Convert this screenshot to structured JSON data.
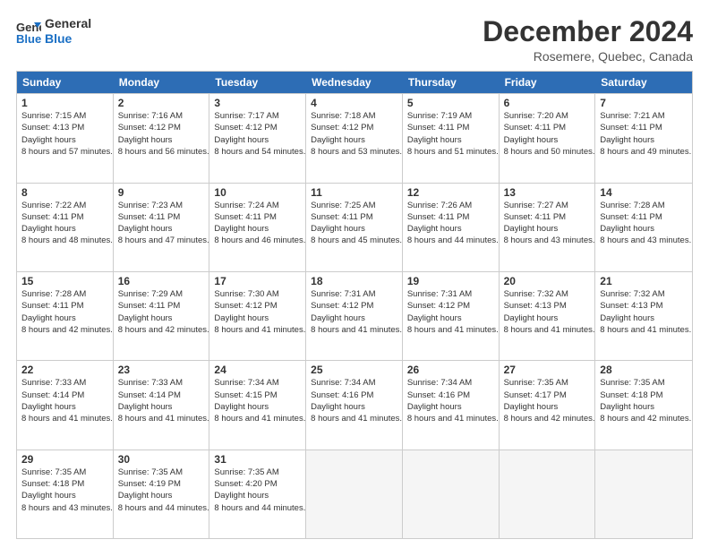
{
  "logo": {
    "line1": "General",
    "line2": "Blue"
  },
  "title": "December 2024",
  "location": "Rosemere, Quebec, Canada",
  "weekdays": [
    "Sunday",
    "Monday",
    "Tuesday",
    "Wednesday",
    "Thursday",
    "Friday",
    "Saturday"
  ],
  "weeks": [
    [
      {
        "day": "1",
        "sunrise": "7:15 AM",
        "sunset": "4:13 PM",
        "daylight": "8 hours and 57 minutes."
      },
      {
        "day": "2",
        "sunrise": "7:16 AM",
        "sunset": "4:12 PM",
        "daylight": "8 hours and 56 minutes."
      },
      {
        "day": "3",
        "sunrise": "7:17 AM",
        "sunset": "4:12 PM",
        "daylight": "8 hours and 54 minutes."
      },
      {
        "day": "4",
        "sunrise": "7:18 AM",
        "sunset": "4:12 PM",
        "daylight": "8 hours and 53 minutes."
      },
      {
        "day": "5",
        "sunrise": "7:19 AM",
        "sunset": "4:11 PM",
        "daylight": "8 hours and 51 minutes."
      },
      {
        "day": "6",
        "sunrise": "7:20 AM",
        "sunset": "4:11 PM",
        "daylight": "8 hours and 50 minutes."
      },
      {
        "day": "7",
        "sunrise": "7:21 AM",
        "sunset": "4:11 PM",
        "daylight": "8 hours and 49 minutes."
      }
    ],
    [
      {
        "day": "8",
        "sunrise": "7:22 AM",
        "sunset": "4:11 PM",
        "daylight": "8 hours and 48 minutes."
      },
      {
        "day": "9",
        "sunrise": "7:23 AM",
        "sunset": "4:11 PM",
        "daylight": "8 hours and 47 minutes."
      },
      {
        "day": "10",
        "sunrise": "7:24 AM",
        "sunset": "4:11 PM",
        "daylight": "8 hours and 46 minutes."
      },
      {
        "day": "11",
        "sunrise": "7:25 AM",
        "sunset": "4:11 PM",
        "daylight": "8 hours and 45 minutes."
      },
      {
        "day": "12",
        "sunrise": "7:26 AM",
        "sunset": "4:11 PM",
        "daylight": "8 hours and 44 minutes."
      },
      {
        "day": "13",
        "sunrise": "7:27 AM",
        "sunset": "4:11 PM",
        "daylight": "8 hours and 43 minutes."
      },
      {
        "day": "14",
        "sunrise": "7:28 AM",
        "sunset": "4:11 PM",
        "daylight": "8 hours and 43 minutes."
      }
    ],
    [
      {
        "day": "15",
        "sunrise": "7:28 AM",
        "sunset": "4:11 PM",
        "daylight": "8 hours and 42 minutes."
      },
      {
        "day": "16",
        "sunrise": "7:29 AM",
        "sunset": "4:11 PM",
        "daylight": "8 hours and 42 minutes."
      },
      {
        "day": "17",
        "sunrise": "7:30 AM",
        "sunset": "4:12 PM",
        "daylight": "8 hours and 41 minutes."
      },
      {
        "day": "18",
        "sunrise": "7:31 AM",
        "sunset": "4:12 PM",
        "daylight": "8 hours and 41 minutes."
      },
      {
        "day": "19",
        "sunrise": "7:31 AM",
        "sunset": "4:12 PM",
        "daylight": "8 hours and 41 minutes."
      },
      {
        "day": "20",
        "sunrise": "7:32 AM",
        "sunset": "4:13 PM",
        "daylight": "8 hours and 41 minutes."
      },
      {
        "day": "21",
        "sunrise": "7:32 AM",
        "sunset": "4:13 PM",
        "daylight": "8 hours and 41 minutes."
      }
    ],
    [
      {
        "day": "22",
        "sunrise": "7:33 AM",
        "sunset": "4:14 PM",
        "daylight": "8 hours and 41 minutes."
      },
      {
        "day": "23",
        "sunrise": "7:33 AM",
        "sunset": "4:14 PM",
        "daylight": "8 hours and 41 minutes."
      },
      {
        "day": "24",
        "sunrise": "7:34 AM",
        "sunset": "4:15 PM",
        "daylight": "8 hours and 41 minutes."
      },
      {
        "day": "25",
        "sunrise": "7:34 AM",
        "sunset": "4:16 PM",
        "daylight": "8 hours and 41 minutes."
      },
      {
        "day": "26",
        "sunrise": "7:34 AM",
        "sunset": "4:16 PM",
        "daylight": "8 hours and 41 minutes."
      },
      {
        "day": "27",
        "sunrise": "7:35 AM",
        "sunset": "4:17 PM",
        "daylight": "8 hours and 42 minutes."
      },
      {
        "day": "28",
        "sunrise": "7:35 AM",
        "sunset": "4:18 PM",
        "daylight": "8 hours and 42 minutes."
      }
    ],
    [
      {
        "day": "29",
        "sunrise": "7:35 AM",
        "sunset": "4:18 PM",
        "daylight": "8 hours and 43 minutes."
      },
      {
        "day": "30",
        "sunrise": "7:35 AM",
        "sunset": "4:19 PM",
        "daylight": "8 hours and 44 minutes."
      },
      {
        "day": "31",
        "sunrise": "7:35 AM",
        "sunset": "4:20 PM",
        "daylight": "8 hours and 44 minutes."
      },
      null,
      null,
      null,
      null
    ]
  ]
}
